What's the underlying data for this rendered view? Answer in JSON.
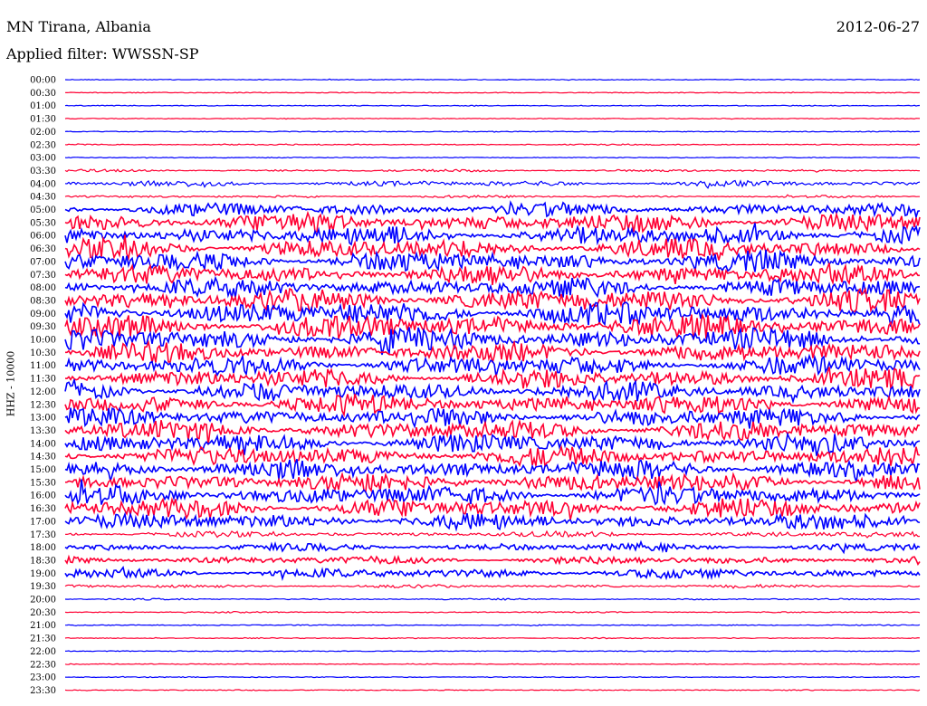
{
  "header": {
    "station": "MN Tirana, Albania",
    "date": "2012-06-27",
    "filter": "Applied filter: WWSSN-SP"
  },
  "colors": {
    "even_trace": "#0000ff",
    "odd_trace": "#ff0033",
    "background": "#ffffff"
  },
  "chart_data": {
    "type": "line",
    "title": "MN Tirana, Albania",
    "subtitle": "Applied filter: WWSSN-SP",
    "ylabel": "HHZ - 10000",
    "xlabel": "",
    "grid": false,
    "categories": [
      "00:00",
      "00:30",
      "01:00",
      "01:30",
      "02:00",
      "02:30",
      "03:00",
      "03:30",
      "04:00",
      "04:30",
      "05:00",
      "05:30",
      "06:00",
      "06:30",
      "07:00",
      "07:30",
      "08:00",
      "08:30",
      "09:00",
      "09:30",
      "10:00",
      "10:30",
      "11:00",
      "11:30",
      "12:00",
      "12:30",
      "13:00",
      "13:30",
      "14:00",
      "14:30",
      "15:00",
      "15:30",
      "16:00",
      "16:30",
      "17:00",
      "17:30",
      "18:00",
      "18:30",
      "19:00",
      "19:30",
      "20:00",
      "20:30",
      "21:00",
      "21:30",
      "22:00",
      "22:30",
      "23:00",
      "23:30"
    ],
    "series": [
      {
        "values": [
          0.3,
          0.3,
          0.3,
          0.3,
          0.5,
          0.8,
          0.4,
          1.5,
          3.5,
          1.5,
          8,
          12,
          12,
          12,
          12,
          12,
          12,
          14,
          15,
          15,
          14,
          12,
          12,
          12,
          12,
          12,
          12,
          12,
          12,
          12,
          12,
          12,
          12,
          12,
          10,
          3.5,
          4.5,
          5,
          6,
          2,
          1,
          0.8,
          0.6,
          0.7,
          0.5,
          0.5,
          0.5,
          0.6
        ]
      }
    ]
  }
}
